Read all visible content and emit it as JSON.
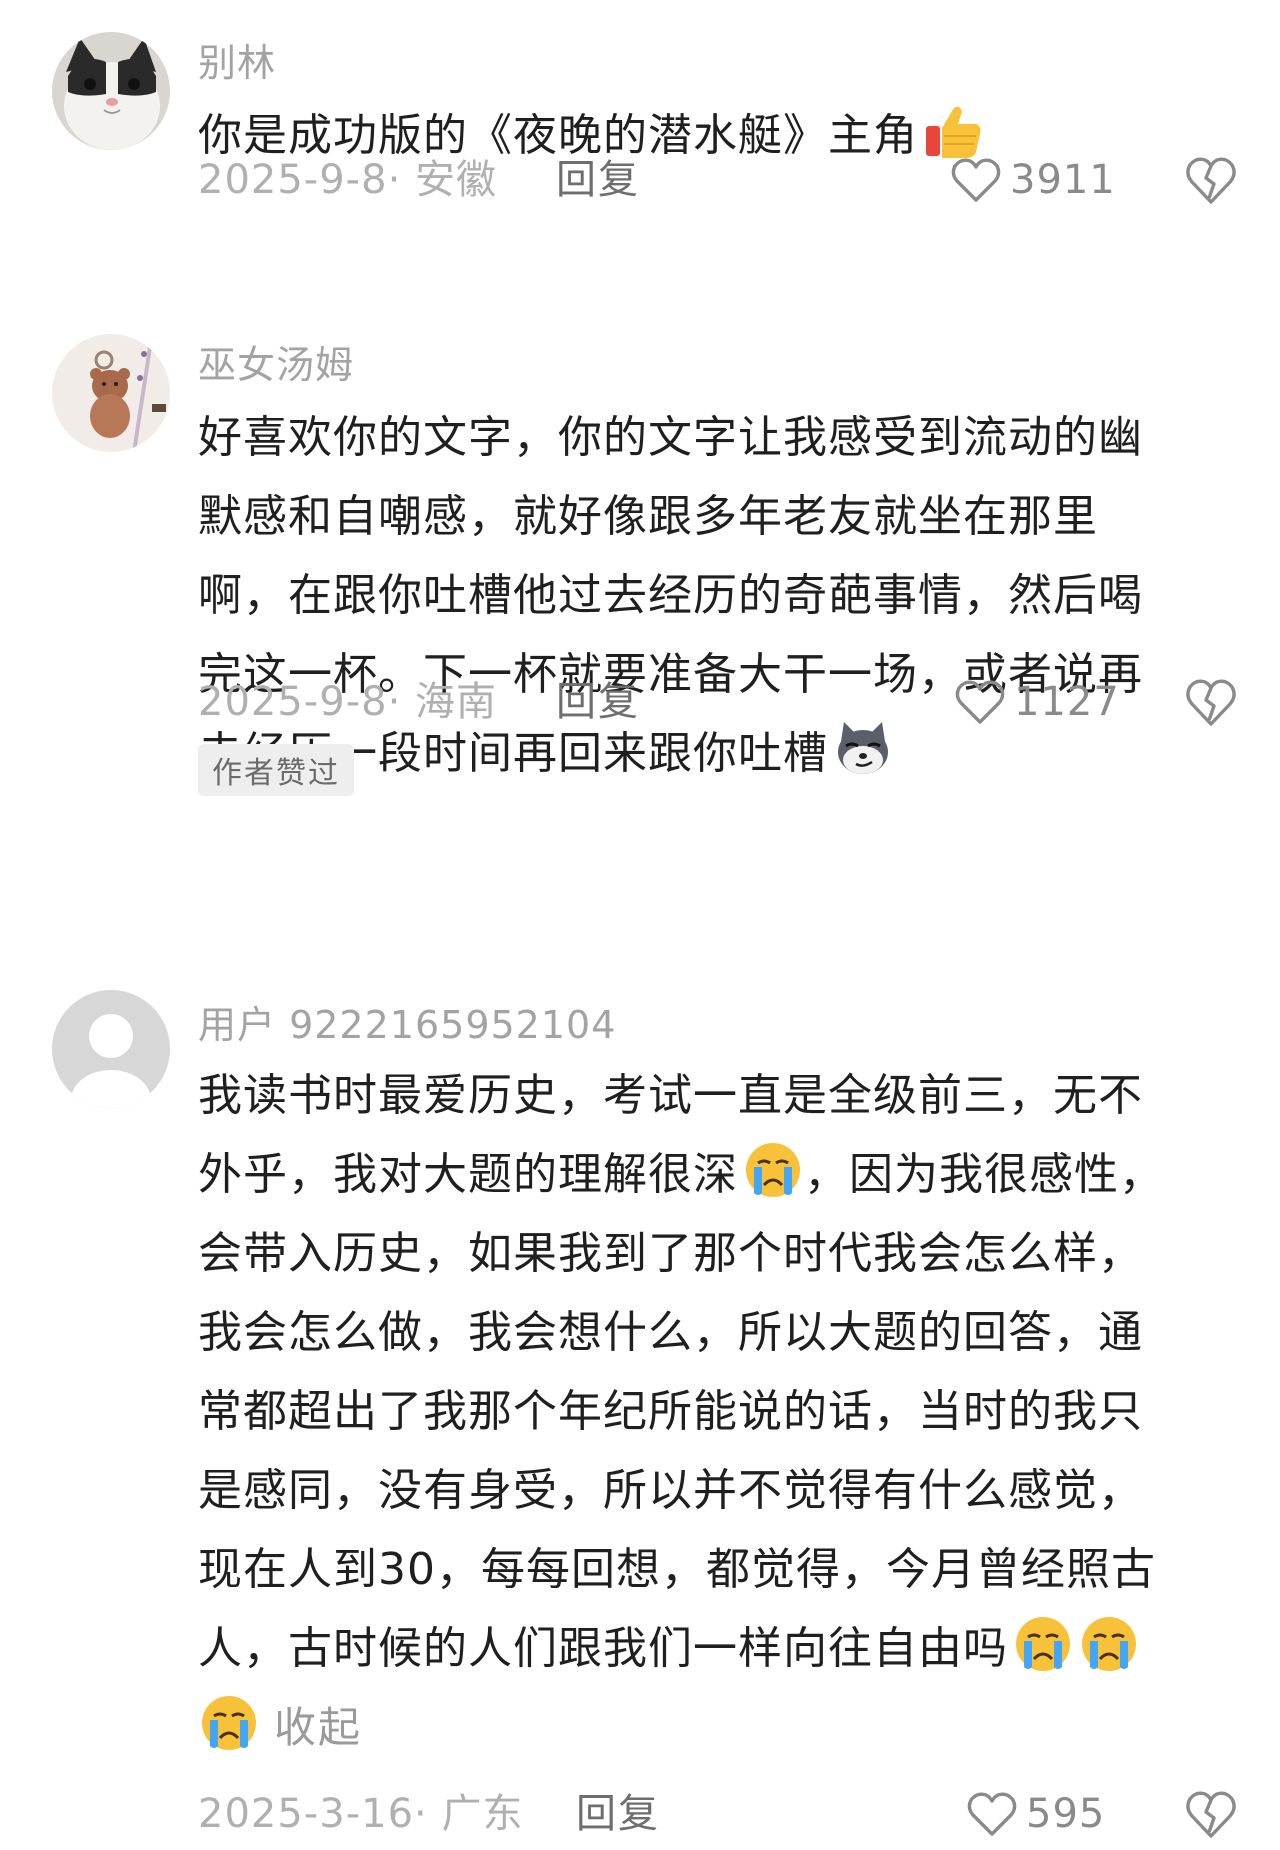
{
  "comments": [
    {
      "username": "别林",
      "avatar_icon": "cat-avatar",
      "lines": [
        "你是成功版的《夜晚的潜水艇》主角"
      ],
      "trailing_emoji": "thumbs-up-emoji",
      "date_location": "2025-9-8· 安徽",
      "reply_label": "回复",
      "like_count": "3911"
    },
    {
      "username": "巫女汤姆",
      "avatar_icon": "bear-keychain-avatar",
      "lines": [
        "好喜欢你的文字，你的文字让我感受到流动的幽",
        "默感和自嘲感，就好像跟多年老友就坐在那里",
        "啊，在跟你吐槽他过去经历的奇葩事情，然后喝",
        "完这一杯。下一杯就要准备大干一场，或者说再",
        "去经历一段时间再回来跟你吐槽"
      ],
      "trailing_emoji": "husky-smirk-emoji",
      "date_location": "2025-9-8· 海南",
      "reply_label": "回复",
      "like_count": "1127",
      "badge": "作者赞过"
    },
    {
      "username": "用户 9222165952104",
      "avatar_icon": "default-user-avatar",
      "lines": [
        "我读书时最爱历史，考试一直是全级前三，无不",
        "外乎，我对大题的理解很深",
        "会带入历史，如果我到了那个时代我会怎么样，",
        "我会怎么做，我会想什么，所以大题的回答，通",
        "常都超出了我那个年纪所能说的话，当时的我只",
        "是感同，没有身受，所以并不觉得有什么感觉，",
        "现在人到30，每每回想，都觉得，今月曾经照古",
        "人，古时候的人们跟我们一样向往自由吗"
      ],
      "line2_suffix": "，因为我很感性，",
      "collapse_label": "收起",
      "date_location": "2025-3-16· 广东",
      "reply_label": "回复",
      "like_count": "595"
    }
  ]
}
